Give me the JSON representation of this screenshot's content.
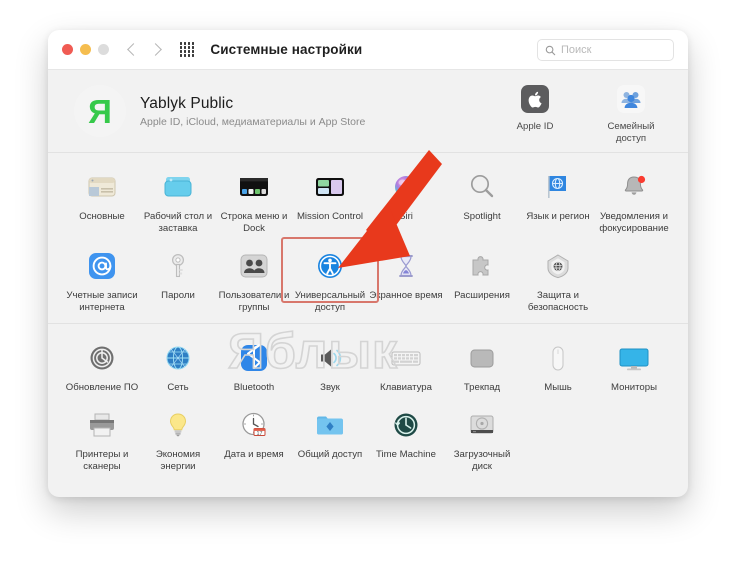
{
  "window": {
    "title": "Системные настройки",
    "search_placeholder": "Поиск"
  },
  "account": {
    "avatar_letter": "Я",
    "name": "Yablyk Public",
    "subtitle": "Apple ID, iCloud, медиаматериалы и App Store",
    "tiles": [
      {
        "label": "Apple ID",
        "icon": "apple-id-icon"
      },
      {
        "label": "Семейный доступ",
        "icon": "family-sharing-icon"
      }
    ]
  },
  "preferences": [
    {
      "label": "Основные",
      "icon": "general-icon"
    },
    {
      "label": "Рабочий стол и заставка",
      "icon": "desktop-screensaver-icon"
    },
    {
      "label": "Строка меню и Dock",
      "icon": "dock-menubar-icon"
    },
    {
      "label": "Mission Control",
      "icon": "mission-control-icon"
    },
    {
      "label": "Siri",
      "icon": "siri-icon"
    },
    {
      "label": "Spotlight",
      "icon": "spotlight-icon"
    },
    {
      "label": "Язык и регион",
      "icon": "language-region-icon"
    },
    {
      "label": "Уведомления и фокусирование",
      "icon": "notifications-focus-icon"
    },
    {
      "label": "Учетные записи интернета",
      "icon": "internet-accounts-icon"
    },
    {
      "label": "Пароли",
      "icon": "passwords-icon"
    },
    {
      "label": "Пользователи и группы",
      "icon": "users-groups-icon"
    },
    {
      "label": "Универсальный доступ",
      "icon": "accessibility-icon"
    },
    {
      "label": "Экранное время",
      "icon": "screen-time-icon"
    },
    {
      "label": "Расширения",
      "icon": "extensions-icon"
    },
    {
      "label": "Защита и безопасность",
      "icon": "security-privacy-icon"
    },
    {
      "label": "Обновление ПО",
      "icon": "software-update-icon"
    },
    {
      "label": "Сеть",
      "icon": "network-icon"
    },
    {
      "label": "Bluetooth",
      "icon": "bluetooth-icon"
    },
    {
      "label": "Звук",
      "icon": "sound-icon"
    },
    {
      "label": "Клавиатура",
      "icon": "keyboard-icon"
    },
    {
      "label": "Трекпад",
      "icon": "trackpad-icon"
    },
    {
      "label": "Мышь",
      "icon": "mouse-icon"
    },
    {
      "label": "Мониторы",
      "icon": "displays-icon"
    },
    {
      "label": "Принтеры и сканеры",
      "icon": "printers-scanners-icon"
    },
    {
      "label": "Экономия энергии",
      "icon": "energy-saver-icon"
    },
    {
      "label": "Дата и время",
      "icon": "date-time-icon"
    },
    {
      "label": "Общий доступ",
      "icon": "sharing-icon"
    },
    {
      "label": "Time Machine",
      "icon": "time-machine-icon"
    },
    {
      "label": "Загрузочный диск",
      "icon": "startup-disk-icon"
    }
  ],
  "annotations": {
    "highlight_target": "Универсальный доступ",
    "highlight_color": "#d8776c",
    "arrow_color": "#e8391c"
  },
  "watermark": {
    "text": "Яблык"
  }
}
